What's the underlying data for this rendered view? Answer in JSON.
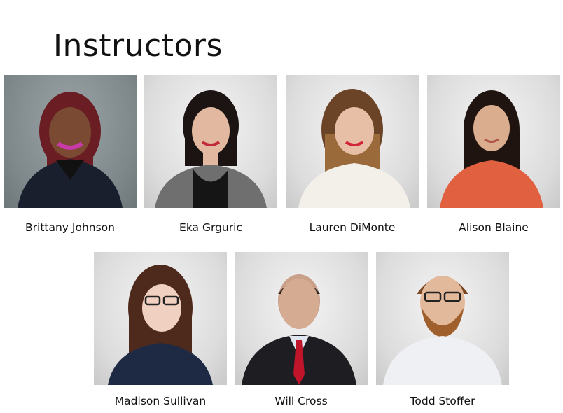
{
  "page": {
    "title": "Instructors"
  },
  "instructors": [
    {
      "name": "Brittany Johnson"
    },
    {
      "name": "Eka Grguric"
    },
    {
      "name": "Lauren DiMonte"
    },
    {
      "name": "Alison Blaine"
    },
    {
      "name": "Madison Sullivan"
    },
    {
      "name": "Will Cross"
    },
    {
      "name": "Todd Stoffer"
    }
  ]
}
